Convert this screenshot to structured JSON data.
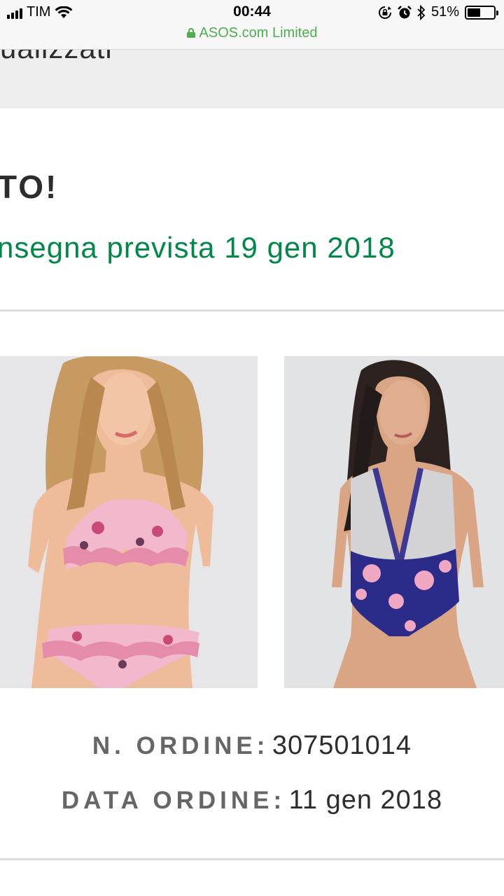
{
  "status_bar": {
    "carrier": "TIM",
    "time": "00:44",
    "url": "ASOS.com Limited",
    "battery_percent": "51%",
    "battery_level": 0.51,
    "icons": [
      "signal-icon",
      "wifi-icon",
      "lock-icon",
      "rotation-lock-icon",
      "alarm-icon",
      "bluetooth-icon",
      "battery-icon"
    ]
  },
  "header": {
    "partial_text": "ualizzati"
  },
  "confirmation": {
    "title": "TO!",
    "delivery": "nsegna prevista 19 gen 2018"
  },
  "products": [
    {
      "alt": "Bikini con volant a fiori rosa"
    },
    {
      "alt": "Costume intero con scollo profondo argento e fiori blu"
    }
  ],
  "order": {
    "number_label": "N. ORDINE:",
    "number_value": "307501014",
    "date_label": "DATA ORDINE:",
    "date_value": "11 gen 2018"
  },
  "colors": {
    "accent_green": "#018849",
    "url_green": "#4caf50",
    "text_dark": "#2d2d2d",
    "label_grey": "#666666"
  }
}
